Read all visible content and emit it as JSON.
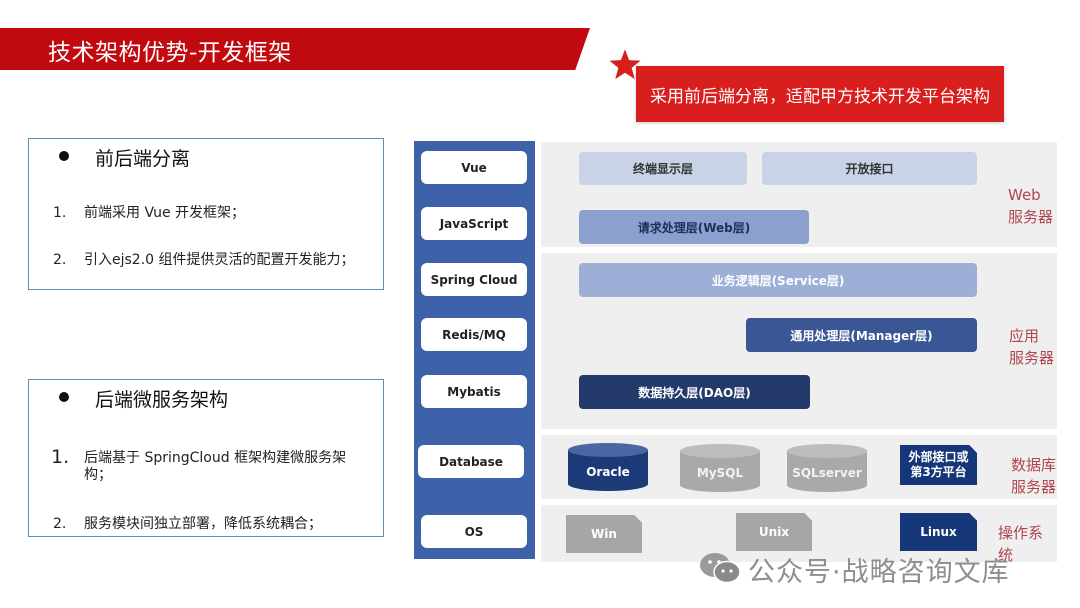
{
  "header": {
    "title": "技术架构优势-开发框架",
    "callout": "采用前后端分离，适配甲方技术开发平台架构",
    "callout_icon": "star-icon"
  },
  "colors": {
    "banner_red": "#c10a0f",
    "callout_red": "#d91e1e",
    "tech_column_blue": "#3d62aa",
    "label_red": "#b0454f",
    "navy": "#16367a"
  },
  "left_panels": [
    {
      "heading": "前后端分离",
      "items": [
        {
          "num": "1.",
          "text": "前端采用 Vue 开发框架；"
        },
        {
          "num": "2.",
          "text": "引入ejs2.0 组件提供灵活的配置开发能力；"
        }
      ]
    },
    {
      "heading": "后端微服务架构",
      "items": [
        {
          "num": "1.",
          "text": "后端基于 SpringCloud 框架构建微服务架构；"
        },
        {
          "num": "2.",
          "text": "服务模块间独立部署，降低系统耦合；"
        }
      ]
    }
  ],
  "diagram": {
    "tech_stack": [
      "Vue",
      "JavaScript",
      "Spring Cloud",
      "Redis/MQ",
      "Mybatis",
      "Database",
      "OS"
    ],
    "web_layer": {
      "bars": [
        "终端显示层",
        "开放接口",
        "请求处理层(Web层)"
      ],
      "label_line1": "Web",
      "label_line2": "服务器"
    },
    "app_layer": {
      "bars": [
        "业务逻辑层(Service层)",
        "通用处理层(Manager层)",
        "数据持久层(DAO层)"
      ],
      "label_line1": "应用",
      "label_line2": "服务器"
    },
    "db_layer": {
      "databases": [
        "Oracle",
        "MySQL",
        "SQLserver"
      ],
      "external_line1": "外部接口或",
      "external_line2": "第3方平台",
      "label_line1": "数据库",
      "label_line2": "服务器"
    },
    "os_layer": {
      "systems": [
        "Win",
        "Unix",
        "Linux"
      ],
      "label": "操作系统"
    }
  },
  "watermark": {
    "icon": "wechat-icon",
    "text": "公众号·战略咨询文库"
  }
}
